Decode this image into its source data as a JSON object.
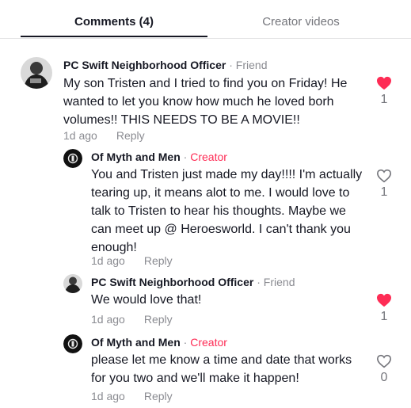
{
  "tabs": {
    "comments": "Comments (4)",
    "creator_videos": "Creator videos"
  },
  "colors": {
    "like_red": "#fe2c55",
    "creator_tag": "#fe2c55",
    "muted": "#8a8b91"
  },
  "comments": [
    {
      "author": "PC Swift Neighborhood Officer",
      "sep": " · ",
      "tag": "Friend",
      "text": "My son Tristen and I tried to find you on Friday! He wanted to let you know how much he loved borh volumes!! THIS NEEDS TO BE A MOVIE!!",
      "time": "1d ago",
      "reply": "Reply",
      "likes": "1",
      "liked": true,
      "avatar_icon": "officer-avatar"
    },
    {
      "author": "Of Myth and Men",
      "sep": " · ",
      "tag": "Creator",
      "text": "You and Tristen just made my day!!!! I'm actually tearing up, it means alot to me. I would love to talk to Tristen to hear his thoughts. Maybe we can meet up @ Heroesworld. I can't thank you enough!",
      "time": "1d ago",
      "reply": "Reply",
      "likes": "1",
      "liked": false,
      "avatar_icon": "creator-logo-avatar"
    },
    {
      "author": "PC Swift Neighborhood Officer",
      "sep": " · ",
      "tag": "Friend",
      "text": "We would love that!",
      "time": "1d ago",
      "reply": "Reply",
      "likes": "1",
      "liked": true,
      "avatar_icon": "officer-avatar"
    },
    {
      "author": "Of Myth and Men",
      "sep": " · ",
      "tag": "Creator",
      "text": "please let me know a time and date that works for you two and we'll make it happen!",
      "time": "1d ago",
      "reply": "Reply",
      "likes": "0",
      "liked": false,
      "avatar_icon": "creator-logo-avatar"
    }
  ]
}
